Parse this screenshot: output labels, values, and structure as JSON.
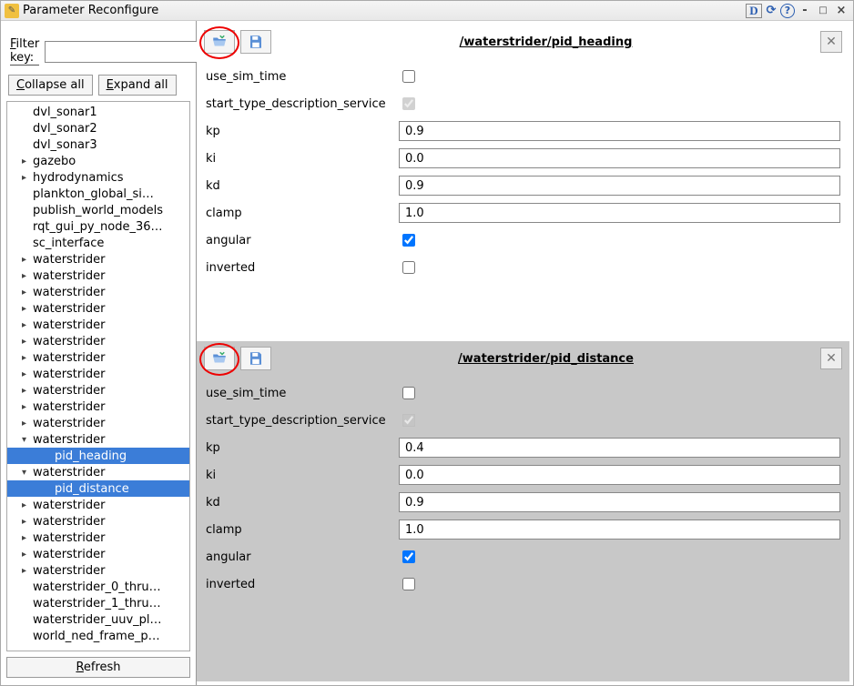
{
  "titlebar": {
    "title": "Parameter Reconfigure",
    "btn_d": "D",
    "btn_refresh": "⟳",
    "btn_help": "?",
    "btn_min": "-",
    "btn_max": "□",
    "btn_close": "×"
  },
  "sidebar": {
    "filter_label": "Filter key:",
    "filter_value": "",
    "collapse_btn": "Collapse all",
    "expand_btn": "Expand all",
    "refresh_btn": "Refresh",
    "tree": [
      {
        "label": "dvl_sonar1",
        "level": 1,
        "expandable": false
      },
      {
        "label": "dvl_sonar2",
        "level": 1,
        "expandable": false
      },
      {
        "label": "dvl_sonar3",
        "level": 1,
        "expandable": false
      },
      {
        "label": "gazebo",
        "level": 1,
        "expandable": true
      },
      {
        "label": "hydrodynamics",
        "level": 1,
        "expandable": true
      },
      {
        "label": "plankton_global_si…",
        "level": 1,
        "expandable": false
      },
      {
        "label": "publish_world_models",
        "level": 1,
        "expandable": false
      },
      {
        "label": "rqt_gui_py_node_36…",
        "level": 1,
        "expandable": false
      },
      {
        "label": "sc_interface",
        "level": 1,
        "expandable": false
      },
      {
        "label": "waterstrider",
        "level": 1,
        "expandable": true
      },
      {
        "label": "waterstrider",
        "level": 1,
        "expandable": true
      },
      {
        "label": "waterstrider",
        "level": 1,
        "expandable": true
      },
      {
        "label": "waterstrider",
        "level": 1,
        "expandable": true
      },
      {
        "label": "waterstrider",
        "level": 1,
        "expandable": true
      },
      {
        "label": "waterstrider",
        "level": 1,
        "expandable": true
      },
      {
        "label": "waterstrider",
        "level": 1,
        "expandable": true
      },
      {
        "label": "waterstrider",
        "level": 1,
        "expandable": true
      },
      {
        "label": "waterstrider",
        "level": 1,
        "expandable": true
      },
      {
        "label": "waterstrider",
        "level": 1,
        "expandable": true
      },
      {
        "label": "waterstrider",
        "level": 1,
        "expandable": true
      },
      {
        "label": "waterstrider",
        "level": 1,
        "expandable": true,
        "expanded": true
      },
      {
        "label": "pid_heading",
        "level": 2,
        "selected": true
      },
      {
        "label": "waterstrider",
        "level": 1,
        "expandable": true,
        "expanded": true
      },
      {
        "label": "pid_distance",
        "level": 2,
        "selected": true
      },
      {
        "label": "waterstrider",
        "level": 1,
        "expandable": true
      },
      {
        "label": "waterstrider",
        "level": 1,
        "expandable": true
      },
      {
        "label": "waterstrider",
        "level": 1,
        "expandable": true
      },
      {
        "label": "waterstrider",
        "level": 1,
        "expandable": true
      },
      {
        "label": "waterstrider",
        "level": 1,
        "expandable": true
      },
      {
        "label": "waterstrider_0_thru…",
        "level": 1,
        "expandable": false
      },
      {
        "label": "waterstrider_1_thru…",
        "level": 1,
        "expandable": false
      },
      {
        "label": "waterstrider_uuv_pl…",
        "level": 1,
        "expandable": false
      },
      {
        "label": "world_ned_frame_p…",
        "level": 1,
        "expandable": false
      }
    ]
  },
  "panels": [
    {
      "title": "/waterstrider/pid_heading",
      "bg": "light",
      "params": [
        {
          "name": "use_sim_time",
          "type": "check",
          "checked": false
        },
        {
          "name": "start_type_description_service",
          "type": "check",
          "checked": true,
          "disabled": true
        },
        {
          "name": "kp",
          "type": "text",
          "value": "0.9"
        },
        {
          "name": "ki",
          "type": "text",
          "value": "0.0"
        },
        {
          "name": "kd",
          "type": "text",
          "value": "0.9"
        },
        {
          "name": "clamp",
          "type": "text",
          "value": "1.0"
        },
        {
          "name": "angular",
          "type": "check",
          "checked": true
        },
        {
          "name": "inverted",
          "type": "check",
          "checked": false
        }
      ]
    },
    {
      "title": "/waterstrider/pid_distance",
      "bg": "dark",
      "params": [
        {
          "name": "use_sim_time",
          "type": "check",
          "checked": false
        },
        {
          "name": "start_type_description_service",
          "type": "check",
          "checked": true,
          "disabled": true
        },
        {
          "name": "kp",
          "type": "text",
          "value": "0.4"
        },
        {
          "name": "ki",
          "type": "text",
          "value": "0.0"
        },
        {
          "name": "kd",
          "type": "text",
          "value": "0.9"
        },
        {
          "name": "clamp",
          "type": "text",
          "value": "1.0"
        },
        {
          "name": "angular",
          "type": "check",
          "checked": true
        },
        {
          "name": "inverted",
          "type": "check",
          "checked": false
        }
      ]
    }
  ]
}
